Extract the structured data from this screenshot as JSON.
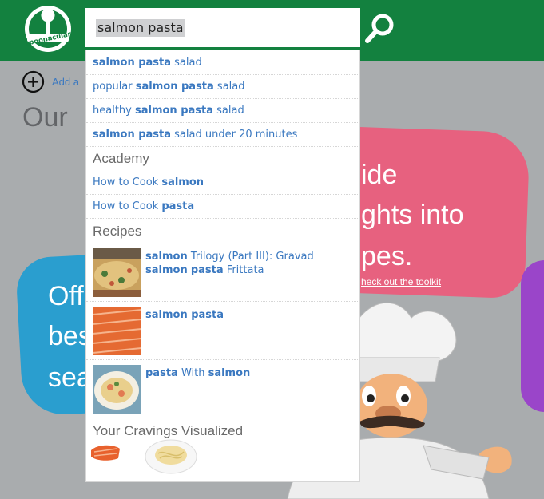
{
  "header": {
    "logo_text": "spoonacular",
    "search_query": "salmon pasta"
  },
  "page": {
    "add_label": "Add a",
    "title": "Our"
  },
  "cards": {
    "pink": {
      "line1": "ide",
      "line2": "ghts into",
      "line3": "pes.",
      "link": "heck out the toolkit"
    },
    "blue": {
      "line1": "Off",
      "line2": "bes",
      "line3": "sea"
    }
  },
  "dropdown": {
    "suggestions": [
      [
        {
          "t": "salmon pasta",
          "b": true
        },
        {
          "t": " salad",
          "b": false
        }
      ],
      [
        {
          "t": "popular ",
          "b": false
        },
        {
          "t": "salmon pasta",
          "b": true
        },
        {
          "t": " salad",
          "b": false
        }
      ],
      [
        {
          "t": "healthy ",
          "b": false
        },
        {
          "t": "salmon pasta",
          "b": true
        },
        {
          "t": " salad",
          "b": false
        }
      ],
      [
        {
          "t": "salmon pasta",
          "b": true
        },
        {
          "t": " salad under 20 minutes",
          "b": false
        }
      ]
    ],
    "academy_heading": "Academy",
    "academy": [
      [
        {
          "t": "How to Cook ",
          "b": false
        },
        {
          "t": "salmon",
          "b": true
        }
      ],
      [
        {
          "t": "How to Cook ",
          "b": false
        },
        {
          "t": "pasta",
          "b": true
        }
      ]
    ],
    "recipes_heading": "Recipes",
    "recipes": [
      [
        {
          "t": "salmon",
          "b": true
        },
        {
          "t": " Trilogy (Part III): Gravad ",
          "b": false
        },
        {
          "t": "salmon",
          "b": true
        },
        {
          "t": " ",
          "b": false
        },
        {
          "t": "pasta",
          "b": true
        },
        {
          "t": " Frittata",
          "b": false
        }
      ],
      [
        {
          "t": "salmon pasta",
          "b": true
        }
      ],
      [
        {
          "t": "pasta",
          "b": true
        },
        {
          "t": " With ",
          "b": false
        },
        {
          "t": "salmon",
          "b": true
        }
      ]
    ],
    "cravings_heading": "Your Cravings Visualized"
  },
  "icons": {
    "logo": "spoonacular-logo",
    "search": "search-icon",
    "add": "plus-circle-icon"
  },
  "colors": {
    "brand_green": "#13813f",
    "link_blue": "#3a78c0",
    "card_pink": "#e7617f",
    "card_blue": "#2a9ecf",
    "card_purple": "#9a45c9"
  }
}
